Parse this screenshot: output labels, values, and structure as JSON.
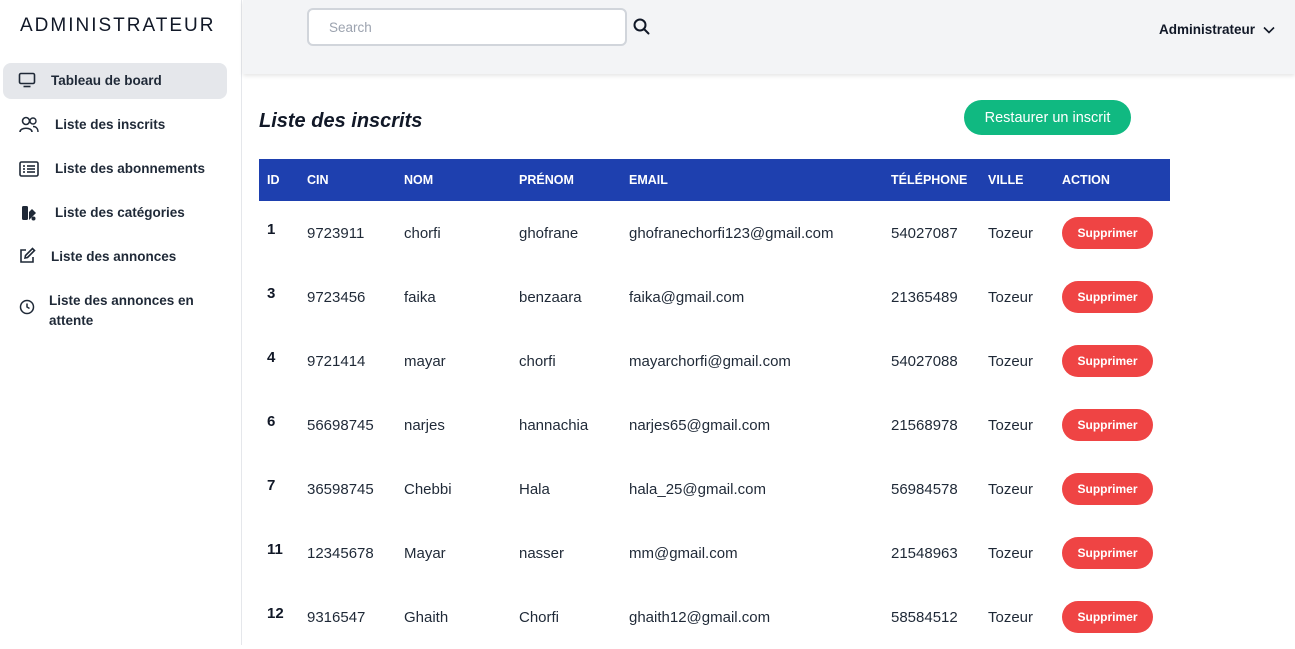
{
  "sidebar": {
    "brand": "ADMINISTRATEUR",
    "items": [
      {
        "label": "Tableau de board",
        "icon": "monitor-icon"
      },
      {
        "label": "Liste des inscrits",
        "icon": "users-icon"
      },
      {
        "label": "Liste des abonnements",
        "icon": "list-icon"
      },
      {
        "label": "Liste des catégories",
        "icon": "categories-icon"
      },
      {
        "label": "Liste des annonces",
        "icon": "edit-icon"
      },
      {
        "label_line1": "Liste des annonces en",
        "label_line2": "attente",
        "icon": "clock-icon"
      }
    ]
  },
  "topbar": {
    "search_placeholder": "Search",
    "user_label": "Administrateur"
  },
  "main": {
    "title": "Liste des inscrits",
    "restore_label": "Restaurer un inscrit",
    "columns": [
      "ID",
      "CIN",
      "NOM",
      "PRÉNOM",
      "EMAIL",
      "TÉLÉPHONE",
      "VILLE",
      "ACTION"
    ],
    "delete_label": "Supprimer",
    "rows": [
      {
        "id": "1",
        "cin": "9723911",
        "nom": "chorfi",
        "prenom": "ghofrane",
        "email": "ghofranechorfi123@gmail.com",
        "tel": "54027087",
        "ville": "Tozeur"
      },
      {
        "id": "3",
        "cin": "9723456",
        "nom": "faika",
        "prenom": "benzaara",
        "email": "faika@gmail.com",
        "tel": "21365489",
        "ville": "Tozeur"
      },
      {
        "id": "4",
        "cin": "9721414",
        "nom": "mayar",
        "prenom": "chorfi",
        "email": "mayarchorfi@gmail.com",
        "tel": "54027088",
        "ville": "Tozeur"
      },
      {
        "id": "6",
        "cin": "56698745",
        "nom": "narjes",
        "prenom": "hannachia",
        "email": "narjes65@gmail.com",
        "tel": "21568978",
        "ville": "Tozeur"
      },
      {
        "id": "7",
        "cin": "36598745",
        "nom": "Chebbi",
        "prenom": "Hala",
        "email": "hala_25@gmail.com",
        "tel": "56984578",
        "ville": "Tozeur"
      },
      {
        "id": "11",
        "cin": "12345678",
        "nom": "Mayar",
        "prenom": "nasser",
        "email": "mm@gmail.com",
        "tel": "21548963",
        "ville": "Tozeur"
      },
      {
        "id": "12",
        "cin": "9316547",
        "nom": "Ghaith",
        "prenom": "Chorfi",
        "email": "ghaith12@gmail.com",
        "tel": "58584512",
        "ville": "Tozeur"
      }
    ]
  },
  "colors": {
    "header_blue": "#1e40af",
    "restore_green": "#10b981",
    "delete_red": "#ef4444",
    "active_nav": "#e5e7eb"
  }
}
